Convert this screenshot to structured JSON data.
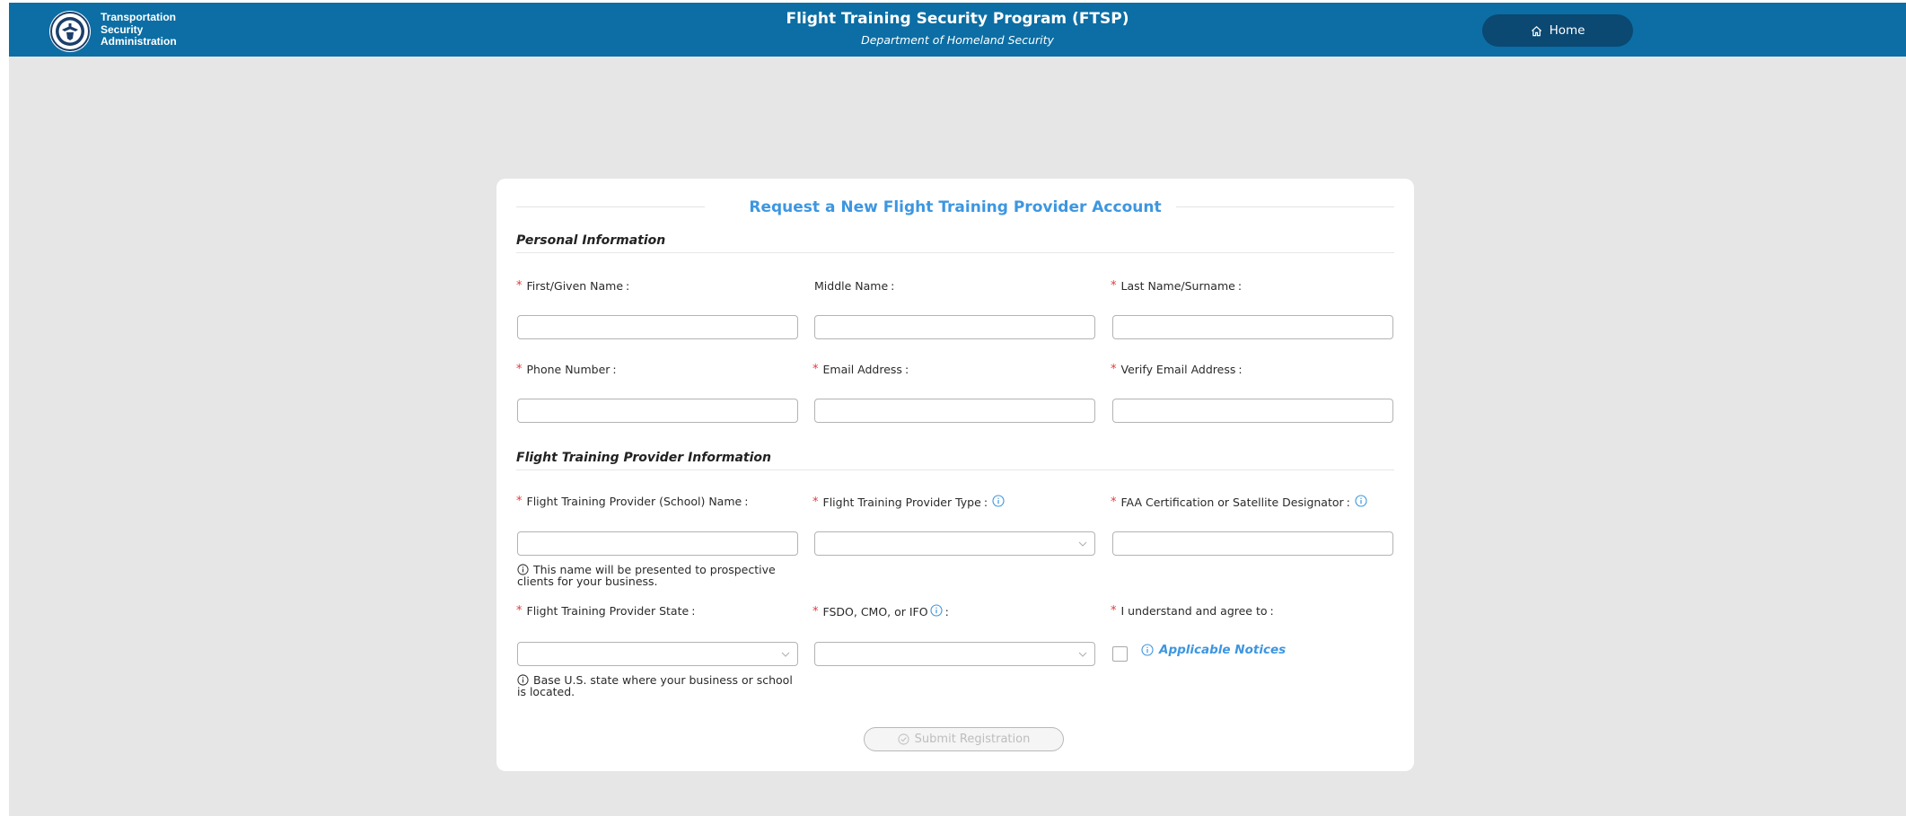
{
  "header": {
    "agency_line1": "Transportation",
    "agency_line2": "Security",
    "agency_line3": "Administration",
    "title": "Flight Training Security Program (FTSP)",
    "subtitle": "Department of Homeland Security",
    "home_label": "Home",
    "home_icon": "home-icon",
    "logo_icon": "dhs-seal-icon"
  },
  "form": {
    "title": "Request a New Flight Training Provider Account",
    "personal_section": "Personal Information",
    "provider_section": "Flight Training Provider Information",
    "required_marker": "*",
    "colon": ":",
    "fields": {
      "first_name": {
        "label": "First/Given Name",
        "value": ""
      },
      "middle_name": {
        "label": "Middle Name",
        "value": ""
      },
      "last_name": {
        "label": "Last Name/Surname",
        "value": ""
      },
      "phone": {
        "label": "Phone Number",
        "value": ""
      },
      "email": {
        "label": "Email Address",
        "value": ""
      },
      "verify_email": {
        "label": "Verify Email Address",
        "value": ""
      },
      "school_name": {
        "label": "Flight Training Provider (School) Name",
        "value": "",
        "hint": "This name will be presented to prospective clients for your business."
      },
      "provider_type": {
        "label": "Flight Training Provider Type",
        "value": ""
      },
      "faa_cert": {
        "label": "FAA Certification or Satellite Designator",
        "value": ""
      },
      "state": {
        "label": "Flight Training Provider State",
        "value": "",
        "hint": "Base U.S. state where your business or school is located."
      },
      "fsdo": {
        "label": "FSDO, CMO, or IFO",
        "value": ""
      },
      "agree": {
        "label": "I understand and agree to",
        "link": "Applicable Notices",
        "checked": false
      }
    },
    "submit_label": "Submit Registration"
  },
  "colors": {
    "header_bg": "#0c6ea4",
    "home_button_bg": "#0b4872",
    "accent": "#3d96e0",
    "required": "#e03a3a",
    "page_bg": "#e6e6e6"
  }
}
